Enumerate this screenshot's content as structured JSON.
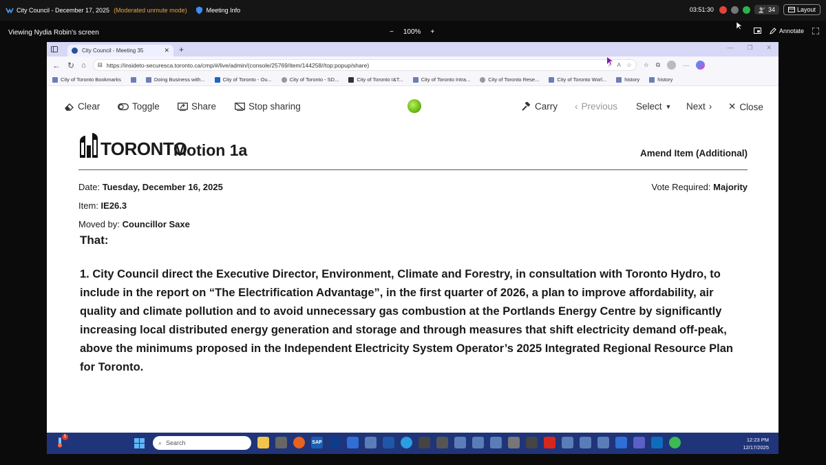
{
  "meeting": {
    "title": "City Council - December 17, 2025",
    "mode": "(Moderated unmute mode)",
    "info_label": "Meeting Info",
    "time": "03:51:30",
    "participants": "34",
    "layout_label": "Layout"
  },
  "share": {
    "viewing": "Viewing Nydia Robin's screen",
    "zoom_out": "−",
    "zoom": "100%",
    "zoom_in": "+",
    "annotate_label": "Annotate"
  },
  "browser": {
    "tab_title": "City Council - Meeting 35",
    "url": "https://insideto-securesca.toronto.ca/cmp/#/live/admin/(console/25769/item/144258//top:popup/share)",
    "bookmarks": [
      "City of Toronto Bookmarks",
      "Doing Business with...",
      "City of Toronto - Ou...",
      "City of Toronto - SD...",
      "City of Toronto I&T...",
      "City of Toronto Intra...",
      "City of Toronto Rese...",
      "City of Toronto Worl...",
      "history",
      "history"
    ]
  },
  "toolbar": {
    "clear": "Clear",
    "toggle": "Toggle",
    "share": "Share",
    "stop_sharing": "Stop sharing",
    "carry": "Carry",
    "previous": "Previous",
    "select": "Select",
    "next": "Next",
    "close": "Close"
  },
  "motion": {
    "logo_text": "TORONTO",
    "title": "Motion 1a",
    "type": "Amend Item (Additional)",
    "date_label": "Date:",
    "date": "Tuesday, December 16, 2025",
    "vote_label": "Vote Required:",
    "vote": "Majority",
    "item_label": "Item:",
    "item": "IE26.3",
    "moved_label": "Moved by:",
    "moved_by": "Councillor Saxe",
    "that": "That:",
    "body": "1. City Council direct the Executive Director, Environment, Climate and Forestry, in consultation with Toronto Hydro, to include in the report on “The Electrification Advantage”, in the first quarter of 2026, a plan to improve affordability, air quality and climate pollution and to avoid unnecessary gas combustion at the Portlands Energy Centre by significantly increasing local distributed energy generation and storage and through measures that shift electricity demand off-peak, above the minimums proposed in the Independent Electricity System Operator’s 2025 Integrated Regional Resource Plan for Toronto."
  },
  "taskbar": {
    "badge": "5",
    "search_placeholder": "Search",
    "time": "12:23 PM",
    "date": "12/17/2025"
  },
  "colors": {
    "meeting_mode": "#e4a44c",
    "edge_tabbar": "#d7d8f6",
    "taskbar": "#20347a",
    "share_dot": "#7fd11b"
  }
}
